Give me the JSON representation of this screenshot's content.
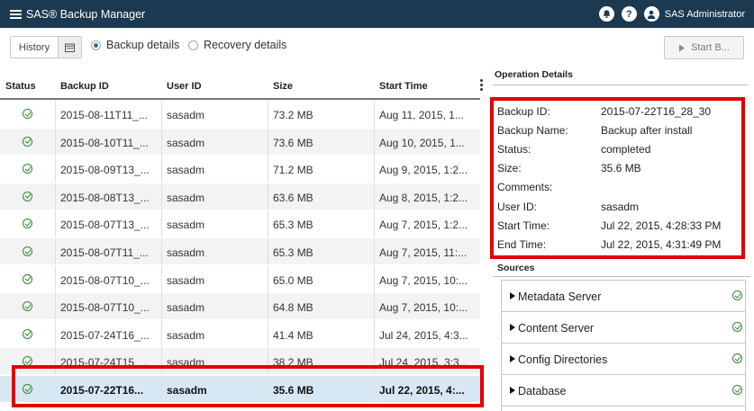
{
  "app": {
    "title": "SAS® Backup Manager",
    "user": "SAS Administrator"
  },
  "icons": {
    "menu": "hamburger-icon",
    "notifications": "bell-icon",
    "help": "help-icon",
    "user": "user-icon",
    "calendar": "calendar-icon",
    "play": "play-icon",
    "status_ok": "check-circle-icon"
  },
  "colors": {
    "titlebar": "#1b3a52",
    "selected_row": "#d7e8f4",
    "highlight": "#e00000",
    "success": "#2e8b2e"
  },
  "toolbar": {
    "history_label": "History",
    "view_options": [
      {
        "label": "Backup details",
        "selected": true
      },
      {
        "label": "Recovery details",
        "selected": false
      }
    ],
    "start_label": "Start B..."
  },
  "table": {
    "columns": [
      "Status",
      "Backup ID",
      "User ID",
      "Size",
      "Start Time"
    ],
    "rows": [
      {
        "backup_id": "2015-08-11T11_...",
        "user_id": "sasadm",
        "size": "73.2 MB",
        "start": "Aug 11, 2015, 1..."
      },
      {
        "backup_id": "2015-08-10T11_...",
        "user_id": "sasadm",
        "size": "73.6 MB",
        "start": "Aug 10, 2015, 1..."
      },
      {
        "backup_id": "2015-08-09T13_...",
        "user_id": "sasadm",
        "size": "71.2 MB",
        "start": "Aug 9, 2015, 1:2..."
      },
      {
        "backup_id": "2015-08-08T13_...",
        "user_id": "sasadm",
        "size": "63.6 MB",
        "start": "Aug 8, 2015, 1:2..."
      },
      {
        "backup_id": "2015-08-07T13_...",
        "user_id": "sasadm",
        "size": "65.3 MB",
        "start": "Aug 7, 2015, 1:2..."
      },
      {
        "backup_id": "2015-08-07T11_...",
        "user_id": "sasadm",
        "size": "65.3 MB",
        "start": "Aug 7, 2015, 11:..."
      },
      {
        "backup_id": "2015-08-07T10_...",
        "user_id": "sasadm",
        "size": "65.0 MB",
        "start": "Aug 7, 2015, 10:..."
      },
      {
        "backup_id": "2015-08-07T10_...",
        "user_id": "sasadm",
        "size": "64.8 MB",
        "start": "Aug 7, 2015, 10:..."
      },
      {
        "backup_id": "2015-07-24T16_...",
        "user_id": "sasadm",
        "size": "41.4 MB",
        "start": "Jul 24, 2015, 4:3..."
      },
      {
        "backup_id": "2015-07-24T15_...",
        "user_id": "sasadm",
        "size": "38.2 MB",
        "start": "Jul 24, 2015, 3:3..."
      },
      {
        "backup_id": "2015-07-22T16...",
        "user_id": "sasadm",
        "size": "35.6 MB",
        "start": "Jul 22, 2015, 4:...",
        "selected": true
      }
    ]
  },
  "details": {
    "title": "Operation Details",
    "fields": [
      {
        "label": "Backup ID:",
        "value": "2015-07-22T16_28_30"
      },
      {
        "label": "Backup Name:",
        "value": "Backup after install"
      },
      {
        "label": "Status:",
        "value": "completed"
      },
      {
        "label": "Size:",
        "value": "35.6 MB"
      },
      {
        "label": "Comments:",
        "value": ""
      },
      {
        "label": "User ID:",
        "value": "sasadm"
      },
      {
        "label": "Start Time:",
        "value": "Jul 22, 2015, 4:28:33 PM"
      },
      {
        "label": "End Time:",
        "value": "Jul 22, 2015, 4:31:49 PM"
      }
    ]
  },
  "sources": {
    "title": "Sources",
    "items": [
      {
        "label": "Metadata Server"
      },
      {
        "label": "Content Server"
      },
      {
        "label": "Config Directories"
      },
      {
        "label": "Database"
      }
    ]
  }
}
